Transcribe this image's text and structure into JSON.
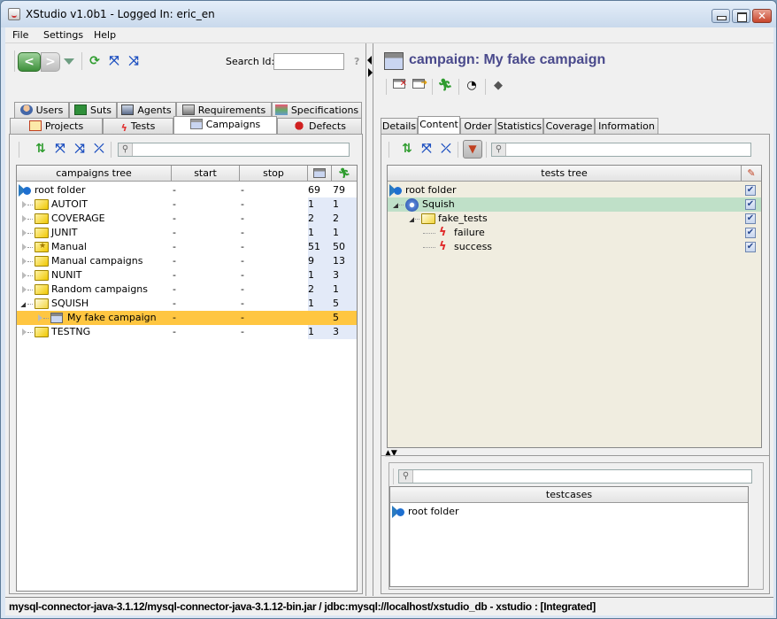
{
  "window": {
    "title": "XStudio v1.0b1 - Logged In: eric_en",
    "controls": {
      "minimize": "minimize",
      "maximize": "maximize",
      "close": "close"
    }
  },
  "menu": [
    "File",
    "Settings",
    "Help"
  ],
  "toolbar": {
    "back_label": "<",
    "forward_label": ">",
    "search_label": "Search Id:",
    "search_value": "",
    "help_label": "?"
  },
  "main_tabs": {
    "row1": [
      {
        "label": "Users",
        "icon": "users-icon"
      },
      {
        "label": "Suts",
        "icon": "suts-icon"
      },
      {
        "label": "Agents",
        "icon": "agents-icon"
      },
      {
        "label": "Requirements",
        "icon": "requirements-icon"
      },
      {
        "label": "Specifications",
        "icon": "specifications-icon"
      }
    ],
    "row2": [
      {
        "label": "Projects",
        "icon": "projects-icon"
      },
      {
        "label": "Tests",
        "icon": "tests-icon"
      },
      {
        "label": "Campaigns",
        "icon": "campaigns-icon",
        "active": true
      },
      {
        "label": "Defects",
        "icon": "defects-icon"
      }
    ]
  },
  "campaigns_tree": {
    "filter_value": "",
    "columns": [
      "campaigns tree",
      "start",
      "stop",
      "#campaigns",
      "#runs"
    ],
    "rows": [
      {
        "name": "root folder",
        "start": "-",
        "stop": "-",
        "c1": "69",
        "c2": "79",
        "type": "root",
        "level": 0
      },
      {
        "name": "AUTOIT",
        "start": "-",
        "stop": "-",
        "c1": "1",
        "c2": "1",
        "type": "folder",
        "level": 1
      },
      {
        "name": "COVERAGE",
        "start": "-",
        "stop": "-",
        "c1": "2",
        "c2": "2",
        "type": "folder",
        "level": 1
      },
      {
        "name": "JUNIT",
        "start": "-",
        "stop": "-",
        "c1": "1",
        "c2": "1",
        "type": "folder",
        "level": 1
      },
      {
        "name": "Manual",
        "start": "-",
        "stop": "-",
        "c1": "51",
        "c2": "50",
        "type": "folder-star",
        "level": 1
      },
      {
        "name": "Manual campaigns",
        "start": "-",
        "stop": "-",
        "c1": "9",
        "c2": "13",
        "type": "folder",
        "level": 1
      },
      {
        "name": "NUNIT",
        "start": "-",
        "stop": "-",
        "c1": "1",
        "c2": "3",
        "type": "folder",
        "level": 1
      },
      {
        "name": "Random campaigns",
        "start": "-",
        "stop": "-",
        "c1": "2",
        "c2": "1",
        "type": "folder",
        "level": 1
      },
      {
        "name": "SQUISH",
        "start": "-",
        "stop": "-",
        "c1": "1",
        "c2": "5",
        "type": "folder-open",
        "level": 1
      },
      {
        "name": "My fake campaign",
        "start": "-",
        "stop": "-",
        "c1": "",
        "c2": "5",
        "type": "campaign",
        "level": 2,
        "selected": true
      },
      {
        "name": "TESTNG",
        "start": "-",
        "stop": "-",
        "c1": "1",
        "c2": "3",
        "type": "folder",
        "level": 1
      }
    ]
  },
  "detail": {
    "title": "campaign: My fake campaign",
    "tabs": [
      "Details",
      "Content",
      "Order",
      "Statistics",
      "Coverage",
      "Information"
    ],
    "active_tab": "Content",
    "tests_tree": {
      "filter_value": "",
      "column": "tests tree",
      "rows": [
        {
          "name": "root folder",
          "type": "root",
          "level": 0,
          "checked": true
        },
        {
          "name": "Squish",
          "type": "gear",
          "level": 1,
          "checked": true,
          "highlighted": true
        },
        {
          "name": "fake_tests",
          "type": "folder-open",
          "level": 2,
          "checked": true
        },
        {
          "name": "failure",
          "type": "test",
          "level": 3,
          "checked": true
        },
        {
          "name": "success",
          "type": "test",
          "level": 3,
          "checked": true
        }
      ]
    },
    "testcases": {
      "filter_value": "",
      "column": "testcases",
      "rows": [
        {
          "name": "root folder",
          "type": "root"
        }
      ]
    }
  },
  "status_bar": "mysql-connector-java-3.1.12/mysql-connector-java-3.1.12-bin.jar / jdbc:mysql://localhost/xstudio_db - xstudio : [Integrated]"
}
